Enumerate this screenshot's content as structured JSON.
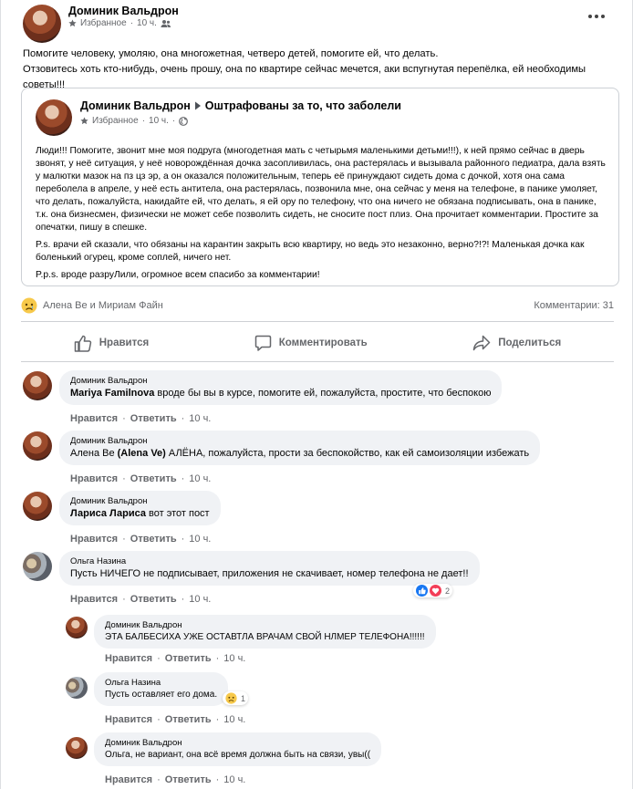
{
  "post": {
    "author": "Доминик Вальдрон",
    "badge": "Избранное",
    "time": "10 ч.",
    "lines": [
      "Помогите человеку, умоляю, она многожетная, четверо детей, помогите ей, что делать.",
      "Отзовитесь хоть кто-нибудь, очень прошу, она по квартире сейчас мечется, аки вспугнутая перепёлка, ей необходимы советы!!!"
    ]
  },
  "shared": {
    "author": "Доминик Вальдрон",
    "group": "Оштрафованы за то, что заболели",
    "badge": "Избранное",
    "time": "10 ч.",
    "para1": "Люди!!! Помогите, звонит мне моя подруга (многодетная мать с четырьмя маленькими детьми!!!), к ней прямо сейчас в дверь звонят, у неё ситуация, у неё новорождённая дочка засопливилась, она растерялась и вызывала районного педиатра, дала взять у малютки мазок на пз цз эр, а он оказался положительным, теперь её принуждают сидеть дома с дочкой, хотя она сама переболела в апреле, у неё есть антитела, она растерялась, позвонила мне, она сейчас у меня на телефоне, в панике умоляет, что делать, пожалуйста, накидайте ей, что делать, я ей ору по телефону, что она ничего не обязана подписывать, она в панике, т.к. она бизнесмен, физически не может себе позволить сидеть, не сносите пост плиз. Она прочитает комментарии. Простите за опечатки, пишу в спешке.",
    "para2": "P.s. врачи ей сказали, что обязаны на карантин закрыть всю квартиру, но ведь это незаконно, верно?!?! Маленькая дочка как боленький огурец, кроме соплей, ничего нет.",
    "para3": "P.p.s. вроде разруЛили, огромное всем спасибо за комментарии!"
  },
  "stats": {
    "reactors": "Алена Ве и Мириам Файн",
    "comments": "Комментарии: 31"
  },
  "actions": {
    "like": "Нравится",
    "comment": "Комментировать",
    "share": "Поделиться"
  },
  "comment_links": {
    "like": "Нравится",
    "reply": "Ответить",
    "dot": "·"
  },
  "comments": [
    {
      "author": "Доминик Вальдрон",
      "mention": "Mariya Familnova",
      "text": " вроде бы вы в курсе, помогите ей, пожалуйста, простите, что беспокою",
      "time": "10 ч."
    },
    {
      "author": "Доминик Вальдрон",
      "pre": "Алена Ве ",
      "mention": "(Alena Ve)",
      "text": " АЛЁНА, пожалуйста, прости за беспокойство, как ей самоизоляции избежать",
      "time": "10 ч."
    },
    {
      "author": "Доминик Вальдрон",
      "mention": "Лариса Лариса",
      "text": " вот этот пост",
      "time": "10 ч."
    },
    {
      "author": "Ольга Назина",
      "text": "Пусть НИЧЕГО не подписывает, приложения не скачивает, номер телефона не дает!!",
      "time": "10 ч.",
      "reactions": "2"
    },
    {
      "author": "Доминик Вальдрон",
      "text": "ЭТА БАЛБЕСИХА УЖЕ ОСТАВТЛА ВРАЧАМ СВОЙ НЛМЕР ТЕЛЕФОНА!!!!!!",
      "time": "10 ч."
    },
    {
      "author": "Ольга Назина",
      "text": "Пусть оставляет его дома.",
      "time": "10 ч.",
      "reactions": "1"
    },
    {
      "author": "Доминик Вальдрон",
      "text": "Ольга, не вариант, она всё время должна быть на связи, увы((",
      "time": "10 ч."
    }
  ],
  "colors": {
    "blue": "#1877f2",
    "gray": "#65676b",
    "bubble": "#f0f2f5"
  }
}
